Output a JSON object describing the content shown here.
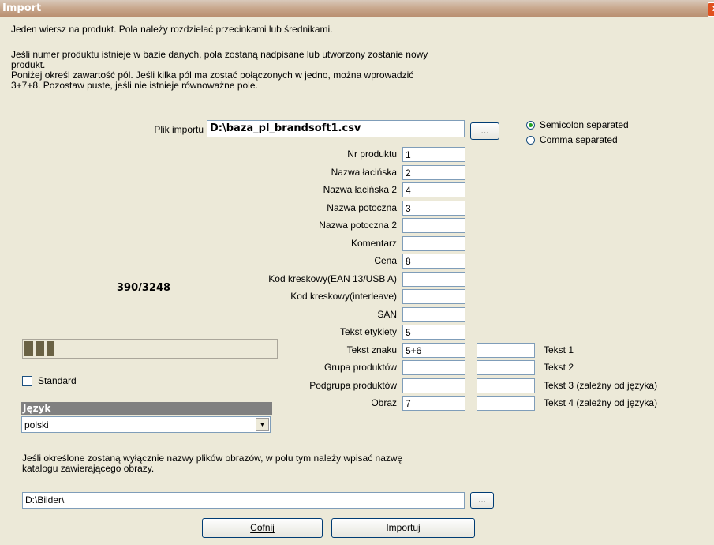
{
  "window": {
    "title": "Import",
    "close_glyph": "x"
  },
  "instructions": {
    "line1": "Jeden wiersz na produkt. Pola należy rozdzielać przecinkami lub średnikami.",
    "line2a": "Jeśli numer produktu istnieje w bazie danych, pola zostaną nadpisane lub utworzony zostanie nowy",
    "line2b": "produkt.",
    "line3a": "Poniżej określ zawartość pól. Jeśli kilka pól ma zostać połączonych w jedno, można wprowadzić",
    "line3b": "3+7+8. Pozostaw puste, jeśli nie istnieje równoważne pole."
  },
  "import_file": {
    "label": "Plik importu",
    "value": "D:\\baza_pl_brandsoft1.csv",
    "browse_label": "..."
  },
  "separator": {
    "semicolon_label": "Semicolon separated",
    "comma_label": "Comma separated",
    "selected": "semicolon"
  },
  "progress": {
    "text": "390/3248",
    "fraction": 0.12
  },
  "fields": [
    {
      "label": "Nr produktu",
      "value": "1"
    },
    {
      "label": "Nazwa łacińska",
      "value": "2"
    },
    {
      "label": "Nazwa łacińska 2",
      "value": "4"
    },
    {
      "label": "Nazwa potoczna",
      "value": "3"
    },
    {
      "label": "Nazwa potoczna 2",
      "value": ""
    },
    {
      "label": "Komentarz",
      "value": ""
    },
    {
      "label": "Cena",
      "value": "8"
    },
    {
      "label": "Kod kreskowy(EAN 13/USB A)",
      "value": ""
    },
    {
      "label": "Kod kreskowy(interleave)",
      "value": ""
    },
    {
      "label": "SAN",
      "value": ""
    },
    {
      "label": "Tekst etykiety",
      "value": "5"
    },
    {
      "label": "Tekst znaku",
      "value": "5+6"
    },
    {
      "label": "Grupa produktów",
      "value": ""
    },
    {
      "label": "Podgrupa produktów",
      "value": ""
    },
    {
      "label": "Obraz",
      "value": "7"
    }
  ],
  "texts": [
    {
      "value": "",
      "label": "Tekst 1"
    },
    {
      "value": "",
      "label": "Tekst 2"
    },
    {
      "value": "",
      "label": "Tekst 3 (zależny od języka)"
    },
    {
      "value": "",
      "label": "Tekst 4 (zależny od języka)"
    }
  ],
  "standard": {
    "label": "Standard",
    "checked": false
  },
  "language": {
    "header": "Język",
    "selected": "polski"
  },
  "images": {
    "note_line1": "Jeśli określone zostaną wyłącznie nazwy plików obrazów, w polu tym należy wpisać nazwę",
    "note_line2": "katalogu zawierającego obrazy.",
    "path": "D:\\Bilder\\",
    "browse_label": "..."
  },
  "buttons": {
    "cancel": "Cofnij",
    "import": "Importuj"
  }
}
